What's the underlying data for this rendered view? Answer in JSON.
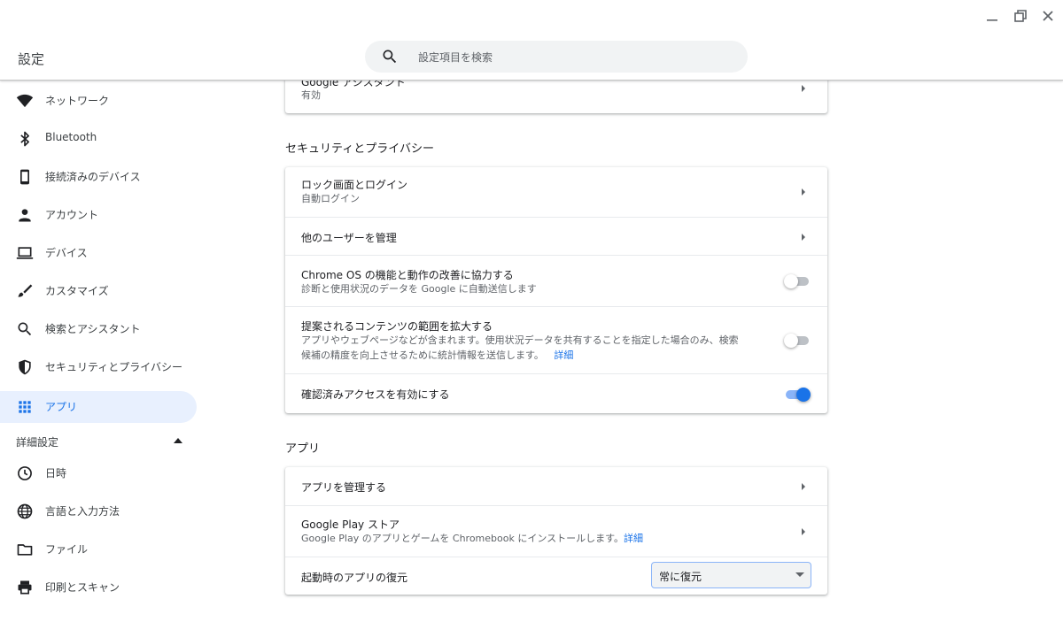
{
  "header": {
    "app_title": "設定",
    "search_placeholder": "設定項目を検索"
  },
  "sidebar": {
    "items": [
      {
        "label": "ネットワーク",
        "icon": "wifi-icon"
      },
      {
        "label": "Bluetooth",
        "icon": "bluetooth-icon"
      },
      {
        "label": "接続済みのデバイス",
        "icon": "phone-icon"
      },
      {
        "label": "アカウント",
        "icon": "person-icon"
      },
      {
        "label": "デバイス",
        "icon": "laptop-icon"
      },
      {
        "label": "カスタマイズ",
        "icon": "brush-icon"
      },
      {
        "label": "検索とアシスタント",
        "icon": "search-icon"
      },
      {
        "label": "セキュリティとプライバシー",
        "icon": "shield-icon"
      },
      {
        "label": "アプリ",
        "icon": "apps-grid-icon",
        "selected": true
      }
    ],
    "advanced_label": "詳細設定",
    "advanced_items": [
      {
        "label": "日時",
        "icon": "clock-icon"
      },
      {
        "label": "言語と入力方法",
        "icon": "globe-icon"
      },
      {
        "label": "ファイル",
        "icon": "folder-icon"
      },
      {
        "label": "印刷とスキャン",
        "icon": "printer-icon"
      }
    ]
  },
  "main": {
    "assistant_card": {
      "title": "Google アシスタント",
      "subtitle": "有効"
    },
    "security_section": {
      "title": "セキュリティとプライバシー",
      "rows": [
        {
          "title": "ロック画面とログイン",
          "subtitle": "自動ログイン"
        },
        {
          "title": "他のユーザーを管理"
        },
        {
          "title": "Chrome OS の機能と動作の改善に協力する",
          "subtitle": "診断と使用状況のデータを Google に自動送信します",
          "toggle_on": false
        },
        {
          "title": "提案されるコンテンツの範囲を拡大する",
          "subtitle_line1": "アプリやウェブページなどが含まれます。使用状況データを共有することを指定した場合のみ、検索",
          "subtitle_line2": "候補の精度を向上させるために統計情報を送信します。",
          "link": "詳細",
          "toggle_on": false
        },
        {
          "title": "確認済みアクセスを有効にする",
          "toggle_on": true
        }
      ]
    },
    "apps_section": {
      "title": "アプリ",
      "rows": [
        {
          "title": "アプリを管理する"
        },
        {
          "title": "Google Play ストア",
          "subtitle": "Google Play のアプリとゲームを Chromebook にインストールします。",
          "link": "詳細"
        },
        {
          "title": "起動時のアプリの復元",
          "select_value": "常に復元"
        }
      ]
    }
  }
}
